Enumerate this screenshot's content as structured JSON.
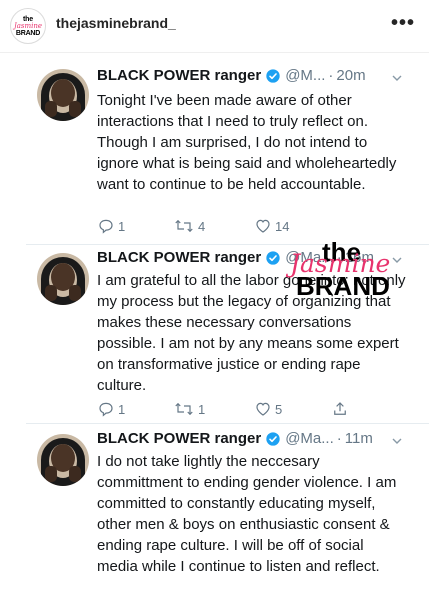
{
  "instagram": {
    "username": "thejasminebrand_",
    "avatar_logo": {
      "line1": "the",
      "line2": "Jasmine",
      "line3": "BRAND"
    }
  },
  "watermark": {
    "line1": "the",
    "line2": "Jasmine",
    "line3": "BRAND"
  },
  "colors": {
    "verified": "#1da1f2",
    "secondary_text": "#657786",
    "brand_pink": "#e8336d"
  },
  "tweets": [
    {
      "name": "BLACK POWER ranger",
      "handle": "@M...",
      "time": "20m",
      "text": "Tonight I've been made aware of other interactions that I need to truly reflect on. Though I am surprised, I do not intend to ignore what is being said and wholeheartedly want to continue to be held accountable.",
      "replies": "1",
      "retweets": "4",
      "likes": "14"
    },
    {
      "name": "BLACK POWER ranger",
      "handle": "@Ma...",
      "time": "16m",
      "text": "I am grateful to all the labor gone into; not only my process but the legacy of organizing that makes these necessary conversations possible. I am not by any means some expert on transformative justice or ending rape culture.",
      "replies": "1",
      "retweets": "1",
      "likes": "5"
    },
    {
      "name": "BLACK POWER ranger",
      "handle": "@Ma...",
      "time": "11m",
      "text": "I do not take lightly the neccesary committment to ending gender violence. I am committed to constantly educating myself, other men & boys on enthusiastic consent & ending rape culture. I will be off of social media while I continue to listen and reflect."
    }
  ]
}
